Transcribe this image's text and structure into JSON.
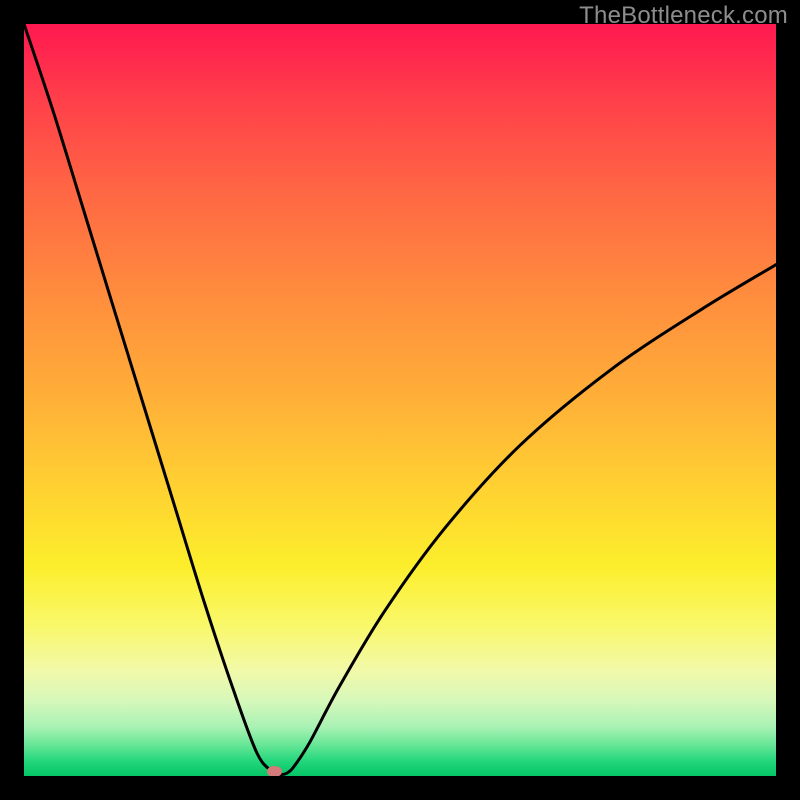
{
  "watermark": "TheBottleneck.com",
  "plot": {
    "inner_width": 752,
    "inner_height": 752,
    "margin": 24
  },
  "chart_data": {
    "type": "line",
    "title": "",
    "xlabel": "",
    "ylabel": "",
    "xlim": [
      0,
      100
    ],
    "ylim": [
      0,
      100
    ],
    "legend": false,
    "grid": false,
    "background": "rainbow-vertical-gradient (red top → green bottom)",
    "series": [
      {
        "name": "bottleneck-curve",
        "stroke": "#000000",
        "stroke_width": 3,
        "x": [
          0,
          4,
          8,
          12,
          16,
          20,
          24,
          28,
          31,
          33,
          34,
          35,
          36,
          38,
          42,
          48,
          56,
          66,
          78,
          90,
          100
        ],
        "y": [
          100,
          88,
          75,
          62,
          49,
          36,
          23,
          11,
          3,
          0.6,
          0.2,
          0.4,
          1.4,
          4.5,
          12,
          22,
          33,
          44,
          54,
          62,
          68
        ]
      }
    ],
    "markers": [
      {
        "name": "min-point",
        "shape": "ellipse",
        "x": 33.3,
        "y": 0.6,
        "rx": 1.0,
        "ry": 0.7,
        "fill": "#d47a7a"
      }
    ],
    "colors": {
      "gradient_stops": [
        {
          "pos": 0.0,
          "hex": "#ff1850"
        },
        {
          "pos": 0.1,
          "hex": "#ff3f4a"
        },
        {
          "pos": 0.22,
          "hex": "#ff6644"
        },
        {
          "pos": 0.35,
          "hex": "#ff8a3e"
        },
        {
          "pos": 0.5,
          "hex": "#ffb038"
        },
        {
          "pos": 0.62,
          "hex": "#ffd231"
        },
        {
          "pos": 0.72,
          "hex": "#fcee2c"
        },
        {
          "pos": 0.8,
          "hex": "#f9f86a"
        },
        {
          "pos": 0.86,
          "hex": "#f2f9a9"
        },
        {
          "pos": 0.9,
          "hex": "#d6f8ba"
        },
        {
          "pos": 0.935,
          "hex": "#a8f2b4"
        },
        {
          "pos": 0.96,
          "hex": "#63e695"
        },
        {
          "pos": 0.98,
          "hex": "#24d77c"
        },
        {
          "pos": 1.0,
          "hex": "#04c566"
        }
      ]
    }
  }
}
